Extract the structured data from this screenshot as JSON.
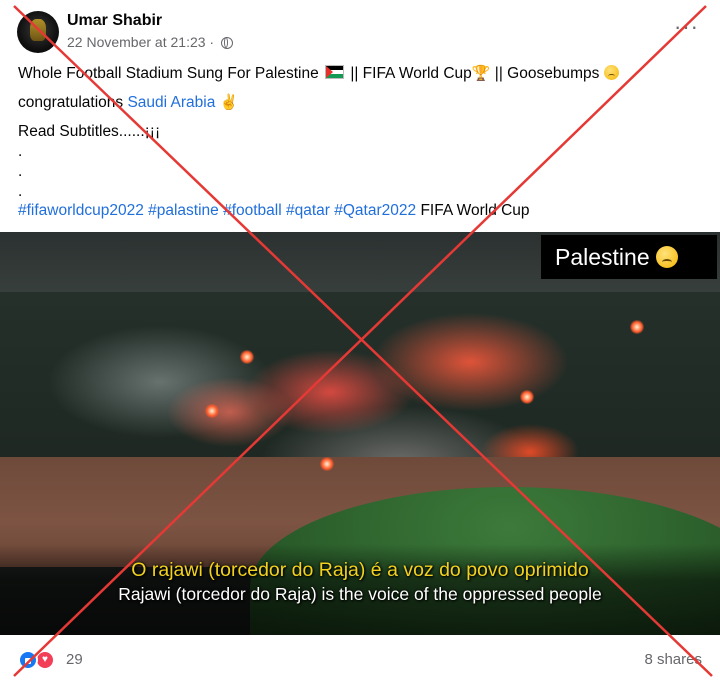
{
  "post": {
    "author": "Umar Shabir",
    "date": "22 November at 21:23",
    "audience_icon": "globe-icon",
    "more_label": "···",
    "lines": {
      "l1_a": "Whole Football Stadium Sung For Palestine",
      "l1_b": "|| FIFA World Cup",
      "l1_c": "|| Goosebumps",
      "l2_a": "congratulations",
      "l2_link": "Saudi Arabia",
      "l3": "Read Subtitles......¡¡¡",
      "dot": ".",
      "hashtags": "#fifaworldcup2022 #palastine #football #qatar #Qatar2022",
      "l7_tail": "FIFA World Cup"
    }
  },
  "video": {
    "badge": "Palestine",
    "subtitle_pt": "O rajawi (torcedor do Raja) é a voz do povo oprimido",
    "subtitle_en": "Rajawi (torcedor do Raja) is the voice of the oppressed people"
  },
  "footer": {
    "reaction_count": "29",
    "shares": "8 shares"
  },
  "colors": {
    "link": "#216fdb",
    "cross": "#e53935",
    "like": "#1877f2",
    "love": "#f33e58"
  }
}
